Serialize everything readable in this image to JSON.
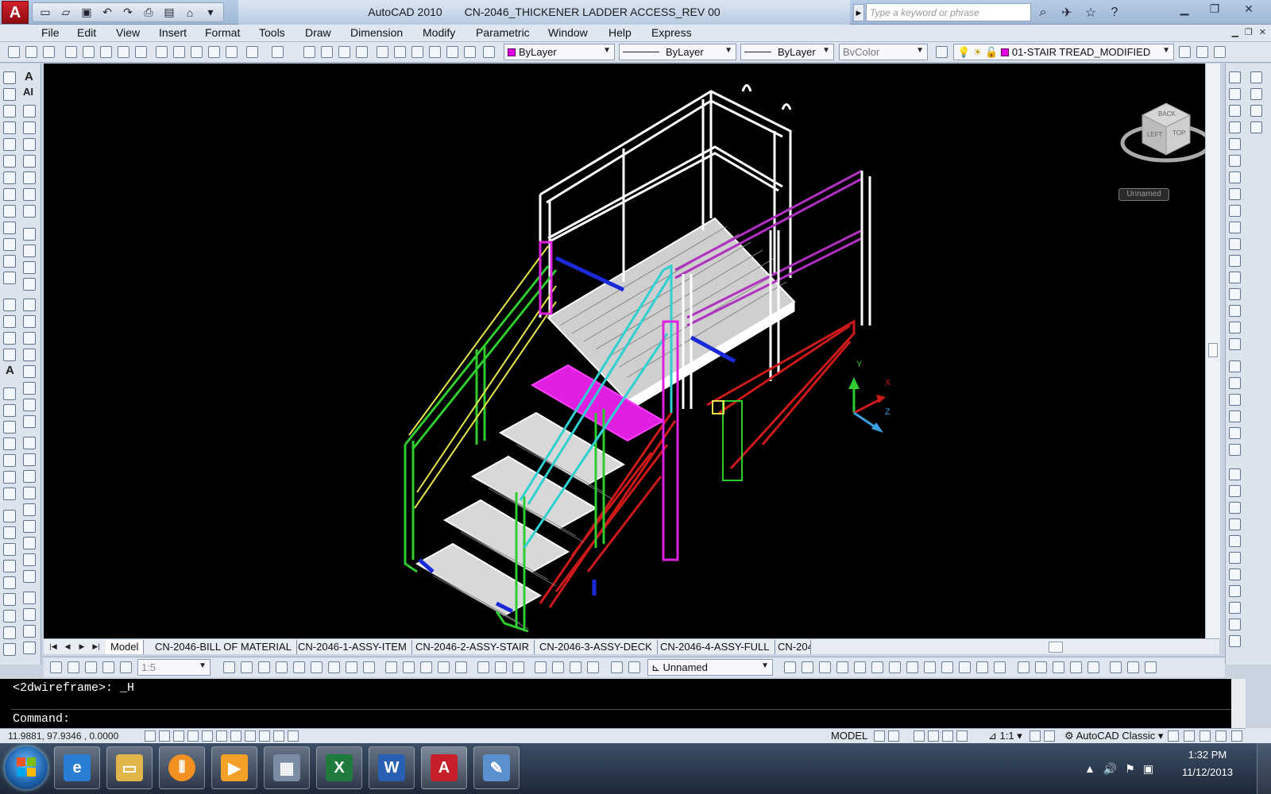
{
  "window": {
    "app_name": "AutoCAD 2010",
    "drawing_name": "CN-2046_THICKENER LADDER ACCESS_REV 00",
    "search_placeholder": "Type a keyword or phrase",
    "app_logo": "A",
    "minimize_icon": "minimize-icon",
    "restore_icon": "restore-icon",
    "close_icon": "close-icon"
  },
  "menu": [
    "File",
    "Edit",
    "View",
    "Insert",
    "Format",
    "Tools",
    "Draw",
    "Dimension",
    "Modify",
    "Parametric",
    "Window",
    "Help",
    "Express"
  ],
  "properties": {
    "color": "ByLayer",
    "linetype": "ByLayer",
    "lineweight": "ByLayer",
    "plotstyle": "BvColor",
    "layer": "01-STAIR TREAD_MODIFIED"
  },
  "viewcube": {
    "faces": [
      "BACK",
      "LEFT",
      "TOP"
    ],
    "ucs_label": "Unnamed"
  },
  "ucs_icon": {
    "x": "X",
    "y": "Y",
    "z": "Z"
  },
  "layout_tabs": [
    {
      "label": "Model",
      "active": true
    },
    {
      "label": "CN-2046-BILL OF MATERIAL",
      "active": false
    },
    {
      "label": "CN-2046-1-ASSY-ITEM",
      "active": false
    },
    {
      "label": "CN-2046-2-ASSY-STAIR",
      "active": false
    },
    {
      "label": "CN-2046-3-ASSY-DECK",
      "active": false
    },
    {
      "label": "CN-2046-4-ASSY-FULL",
      "active": false
    },
    {
      "label": "CN-204",
      "active": false
    }
  ],
  "bottom_toolbar": {
    "scale": "1:5",
    "named_view": "Unnamed"
  },
  "command_line": {
    "history": "<2dwireframe>: _H",
    "prompt": "Command:"
  },
  "status": {
    "coordinates": "11.9881, 97.9346 , 0.0000",
    "space": "MODEL",
    "annotation_scale": "1:1",
    "workspace": "AutoCAD Classic"
  },
  "taskbar": {
    "time": "1:32 PM",
    "date": "11/12/2013",
    "apps": [
      "internet-explorer",
      "windows-explorer",
      "media-app",
      "media-player",
      "calculator",
      "excel",
      "word",
      "autocad",
      "paint"
    ]
  },
  "colors": {
    "canvas": "#000000",
    "rail_white": "#ffffff",
    "stringer_green": "#2ecc2e",
    "rail_yellow": "#e6e64c",
    "support_red": "#cc1a1a",
    "accent_magenta": "#e020e0",
    "beam_blue": "#1a2ad8",
    "edge_cyan": "#30d0d0",
    "purple_rail": "#b030c0"
  }
}
